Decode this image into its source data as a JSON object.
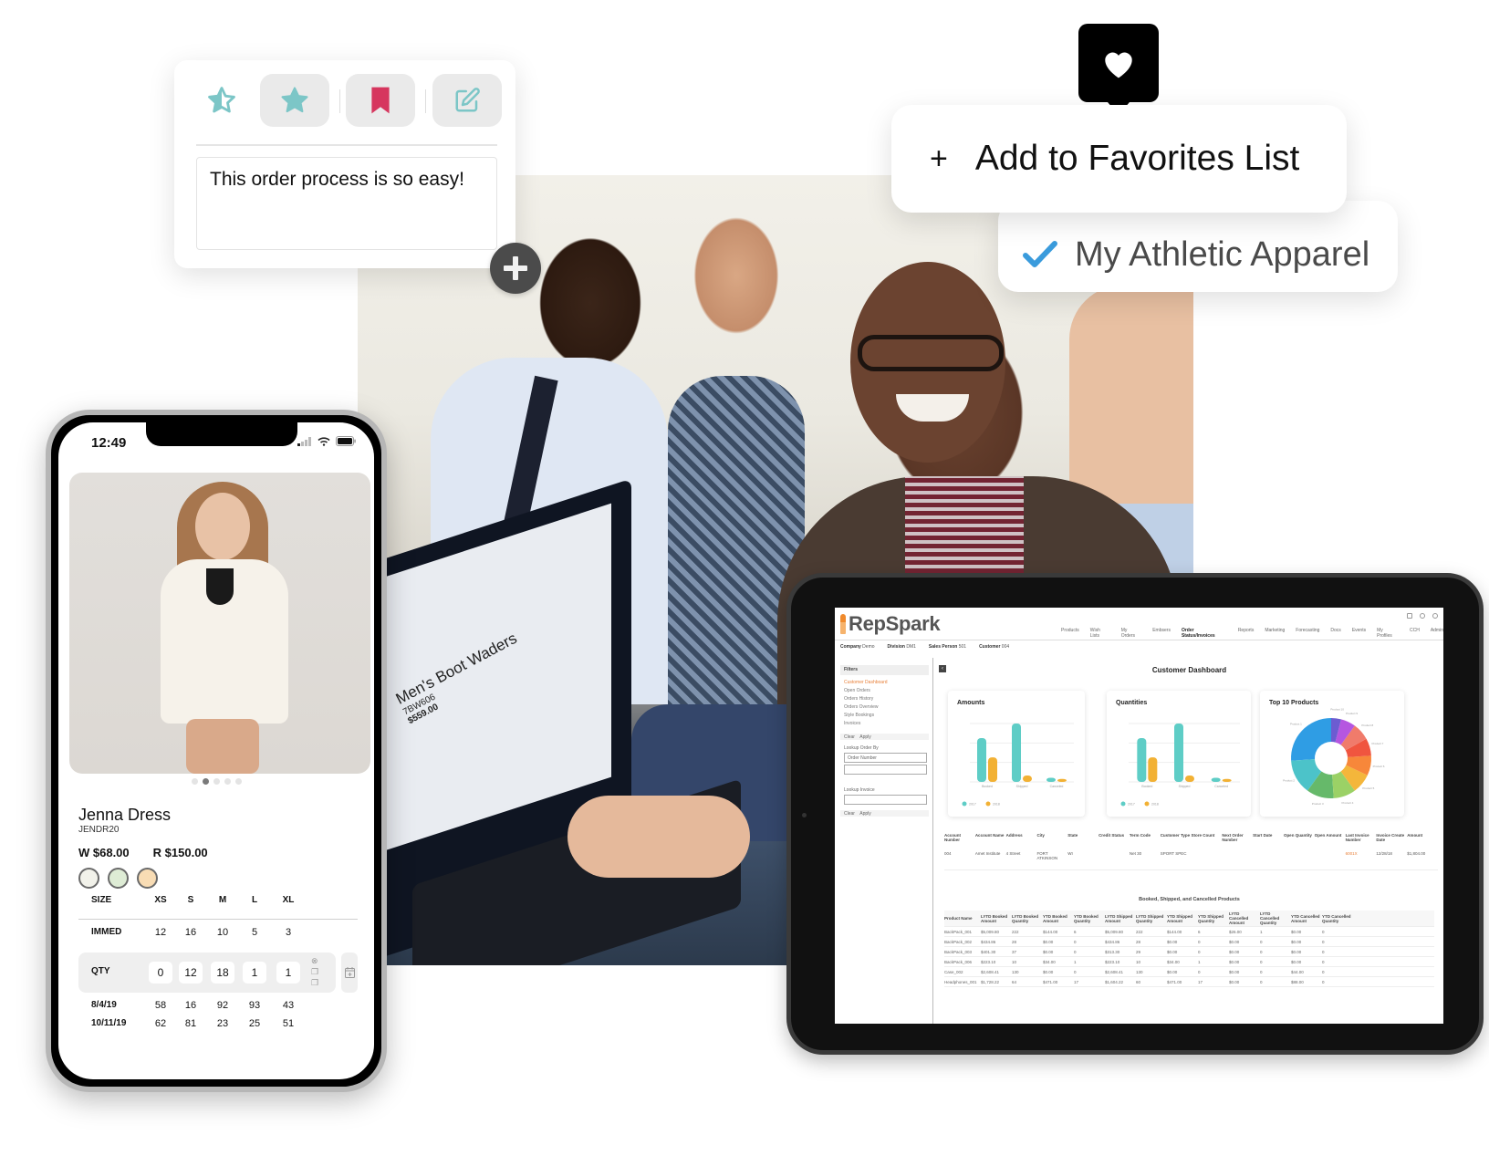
{
  "review_card": {
    "icons": [
      {
        "name": "star-half-icon",
        "active": false
      },
      {
        "name": "star-filled-icon",
        "active": true
      },
      {
        "name": "bookmark-icon",
        "active": true
      },
      {
        "name": "edit-icon",
        "active": true
      }
    ],
    "text": "This order process is so easy!",
    "colors": {
      "teal": "#7cc6c7",
      "pink": "#d6365e",
      "button_bg": "#eaeaea"
    }
  },
  "add_button": {
    "icon": "plus-icon"
  },
  "favorites": {
    "bubble_icon": "heart-icon",
    "add_plus": "+",
    "add_label": "Add to Favorites List",
    "list_item": "My Athletic Apparel",
    "check_color": "#3a9bdc"
  },
  "photo": {
    "laptop_screen": {
      "title": "Men's Boot Waders",
      "sku": "7BW606",
      "price": "$559.00"
    }
  },
  "phone": {
    "time": "12:49",
    "carousel": {
      "count": 5,
      "active": 2
    },
    "product_name": "Jenna Dress",
    "sku": "JENDR20",
    "wholesale_price": "W $68.00",
    "retail_price": "R $150.00",
    "swatches": [
      "#f2f2ea",
      "#deecd5",
      "#f8dcb4"
    ],
    "grid": {
      "size_label": "SIZE",
      "sizes": [
        "XS",
        "S",
        "M",
        "L",
        "XL"
      ],
      "rows": [
        {
          "label": "IMMED",
          "values": [
            "12",
            "16",
            "10",
            "5",
            "3"
          ]
        },
        {
          "label": "QTY",
          "values": [
            "0",
            "12",
            "18",
            "1",
            "1"
          ],
          "editable": true
        },
        {
          "label": "8/4/19",
          "values": [
            "58",
            "16",
            "92",
            "93",
            "43"
          ]
        },
        {
          "label": "10/11/19",
          "values": [
            "62",
            "81",
            "23",
            "25",
            "51"
          ]
        }
      ]
    }
  },
  "tablet": {
    "brand": "RepSpark",
    "brand_color": "#f08a2c",
    "nav": [
      "Products",
      "Wish Lists",
      "My Orders",
      "Embsers",
      "Order Status/Invoices",
      "Reports",
      "Marketing",
      "Forecasting",
      "Docs",
      "Events",
      "My Profiles",
      "CCH",
      "Admin"
    ],
    "nav_active": "Order Status/Invoices",
    "context": [
      {
        "label": "Company",
        "value": "Demo"
      },
      {
        "label": "Division",
        "value": "DM1"
      },
      {
        "label": "Sales Person",
        "value": "501"
      },
      {
        "label": "Customer",
        "value": "004"
      }
    ],
    "sidebar": {
      "heading": "Filters",
      "links": [
        "Customer Dashboard",
        "Open Orders",
        "Orders History",
        "Orders Overview",
        "Style Bookings",
        "Invoices"
      ],
      "active_link": "Customer Dashboard",
      "clear": "Clear",
      "apply": "Apply",
      "lookup_order_label": "Lookup Order By",
      "lookup_order_select": "Order Number",
      "lookup_invoice_label": "Lookup Invoice"
    },
    "dashboard_title": "Customer Dashboard",
    "charts": [
      {
        "title": "Amounts",
        "type": "bar",
        "categories": [
          "Booked",
          "Shipped",
          "Canceled"
        ],
        "series": [
          {
            "name": "2017",
            "color": "#5ecdc6",
            "values": [
              0.75,
              1.0,
              0.07
            ]
          },
          {
            "name": "2018",
            "color": "#f2b134",
            "values": [
              0.42,
              0.11,
              0.05
            ]
          }
        ]
      },
      {
        "title": "Quantities",
        "type": "bar",
        "categories": [
          "Booked",
          "Shipped",
          "Canceled"
        ],
        "series": [
          {
            "name": "2017",
            "color": "#5ecdc6",
            "values": [
              0.75,
              1.0,
              0.07
            ]
          },
          {
            "name": "2018",
            "color": "#f2b134",
            "values": [
              0.42,
              0.11,
              0.05
            ]
          }
        ]
      },
      {
        "title": "Top 10 Products",
        "type": "pie",
        "slices": [
          {
            "label": "Product 1",
            "value": 26,
            "color": "#2f9de4"
          },
          {
            "label": "Product 2",
            "value": 14,
            "color": "#4cc3c9"
          },
          {
            "label": "Product 3",
            "value": 11,
            "color": "#66b96a"
          },
          {
            "label": "Product 4",
            "value": 9,
            "color": "#9bd166"
          },
          {
            "label": "Product 5",
            "value": 8,
            "color": "#f4b63b"
          },
          {
            "label": "Product 6",
            "value": 8,
            "color": "#f7873a"
          },
          {
            "label": "Product 7",
            "value": 7,
            "color": "#f0553f"
          },
          {
            "label": "Product 8",
            "value": 7,
            "color": "#f07b6b"
          },
          {
            "label": "Product 9",
            "value": 6,
            "color": "#b556e0"
          },
          {
            "label": "Product 10",
            "value": 4,
            "color": "#6c5cd1"
          }
        ]
      }
    ],
    "account": {
      "headers": [
        "Account Number",
        "Account Name",
        "Address",
        "City",
        "State",
        "Credit Status",
        "Term Code",
        "Customer Type",
        "Store Count",
        "Next Order Number",
        "Start Date",
        "Open Quantity",
        "Open Amount",
        "Last Invoice Number",
        "Invoice Create Date",
        "Amount"
      ],
      "row": [
        "004",
        "Amet Institute",
        "4 Street",
        "FORT ATKINSON",
        "WI",
        "",
        "Net 30",
        "SPORT SPEC",
        "",
        "",
        "",
        "",
        "",
        "6001X",
        "12/28/18",
        "$1,804.00"
      ]
    },
    "products_table": {
      "title": "Booked, Shipped, and Cancelled Products",
      "headers": [
        "Product Name",
        "LYTD Booked Amount",
        "LYTD Booked Quantity",
        "YTD Booked Amount",
        "YTD Booked Quantity",
        "LYTD Shipped Amount",
        "LYTD Shipped Quantity",
        "YTD Shipped Amount",
        "YTD Shipped Quantity",
        "LYTD Cancelled Amount",
        "LYTD Cancelled Quantity",
        "YTD Cancelled Amount",
        "YTD Cancelled Quantity"
      ],
      "rows": [
        [
          "BackPack_001",
          "$5,009.80",
          "222",
          "$144.00",
          "6",
          "$5,009.80",
          "222",
          "$144.00",
          "6",
          "$26.00",
          "1",
          "$0.00",
          "0"
        ],
        [
          "BackPack_002",
          "$434.86",
          "28",
          "$0.00",
          "0",
          "$434.86",
          "28",
          "$0.00",
          "0",
          "$0.00",
          "0",
          "$0.00",
          "0"
        ],
        [
          "BackPack_003",
          "$401.30",
          "37",
          "$0.00",
          "0",
          "$313.30",
          "29",
          "$0.00",
          "0",
          "$0.00",
          "0",
          "$0.00",
          "0"
        ],
        [
          "BackPack_006",
          "$223.10",
          "10",
          "$34.00",
          "1",
          "$223.10",
          "10",
          "$34.00",
          "1",
          "$0.00",
          "0",
          "$0.00",
          "0"
        ],
        [
          "Case_002",
          "$2,608.41",
          "130",
          "$0.00",
          "0",
          "$2,608.41",
          "130",
          "$0.00",
          "0",
          "$0.00",
          "0",
          "$44.00",
          "0"
        ],
        [
          "Headphones_001",
          "$1,728.22",
          "64",
          "$471.00",
          "17",
          "$1,604.22",
          "60",
          "$471.00",
          "17",
          "$0.00",
          "0",
          "$88.00",
          "0"
        ]
      ]
    }
  }
}
